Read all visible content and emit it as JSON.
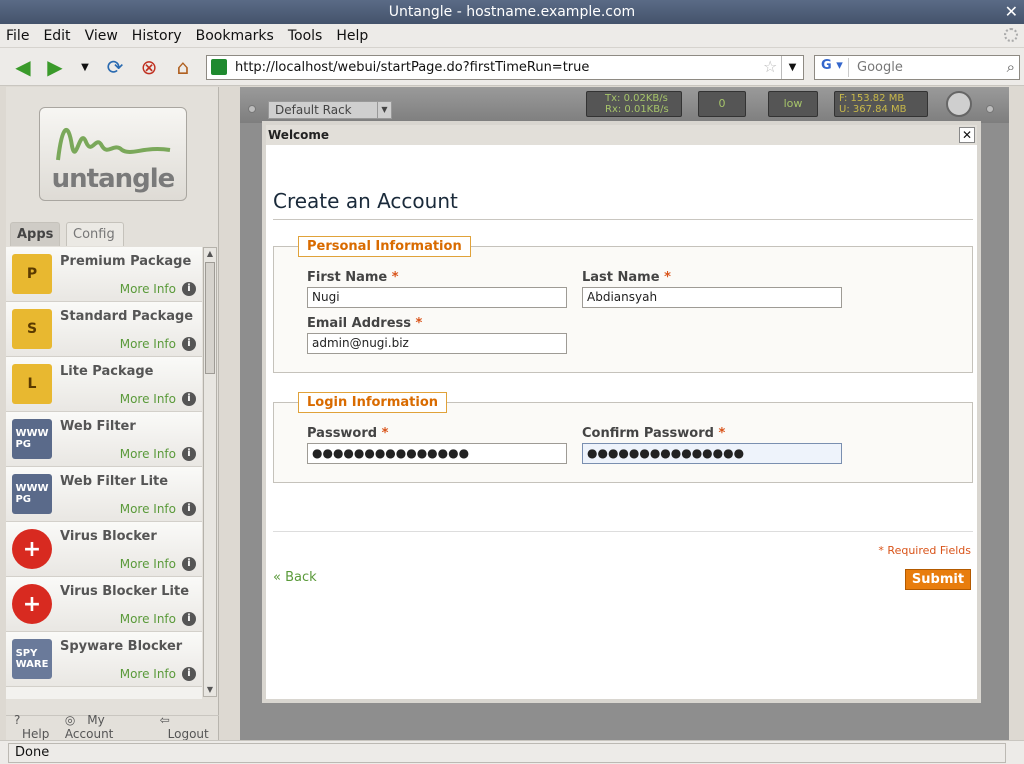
{
  "window": {
    "title": "Untangle - hostname.example.com"
  },
  "menu": [
    "File",
    "Edit",
    "View",
    "History",
    "Bookmarks",
    "Tools",
    "Help"
  ],
  "url": "http://localhost/webui/startPage.do?firstTimeRun=true",
  "search": {
    "engine": "G",
    "placeholder": "Google"
  },
  "sidebar": {
    "logo_text": "untangle",
    "tabs": [
      "Apps",
      "Config"
    ],
    "more_info": "More Info",
    "apps": [
      {
        "name": "Premium Package",
        "icon": "P",
        "kind": "package"
      },
      {
        "name": "Standard Package",
        "icon": "S",
        "kind": "package"
      },
      {
        "name": "Lite Package",
        "icon": "L",
        "kind": "package"
      },
      {
        "name": "Web Filter",
        "icon": "WWW PG",
        "kind": "web"
      },
      {
        "name": "Web Filter Lite",
        "icon": "WWW PG",
        "kind": "web"
      },
      {
        "name": "Virus Blocker",
        "icon": "+",
        "kind": "virus"
      },
      {
        "name": "Virus Blocker Lite",
        "icon": "+",
        "kind": "virus"
      },
      {
        "name": "Spyware Blocker",
        "icon": "SPY WARE",
        "kind": "spy"
      }
    ],
    "footer": {
      "help": "Help",
      "account": "My Account",
      "logout": "Logout"
    }
  },
  "rack": {
    "selected": "Default Rack",
    "tx": "Tx: 0.02KB/s",
    "rx": "Rx: 0.01KB/s",
    "sessions": "0",
    "load": "low",
    "free": "F: 153.82 MB",
    "used": "U: 367.84 MB"
  },
  "dialog": {
    "title": "Welcome",
    "heading": "Create an Account",
    "personal": {
      "legend": "Personal Information",
      "first_label": "First Name",
      "first_value": "Nugi",
      "last_label": "Last Name",
      "last_value": "Abdiansyah",
      "email_label": "Email Address",
      "email_value": "admin@nugi.biz"
    },
    "login": {
      "legend": "Login Information",
      "password_label": "Password",
      "password_value": "●●●●●●●●●●●●●●●",
      "confirm_label": "Confirm Password",
      "confirm_value": "●●●●●●●●●●●●●●●"
    },
    "required_note": "* Required Fields",
    "back": "« Back",
    "submit": "Submit"
  },
  "status": "Done",
  "colors": {
    "accent": "#e87d0d",
    "link": "#5a9a3a",
    "legend": "#d96b00"
  }
}
